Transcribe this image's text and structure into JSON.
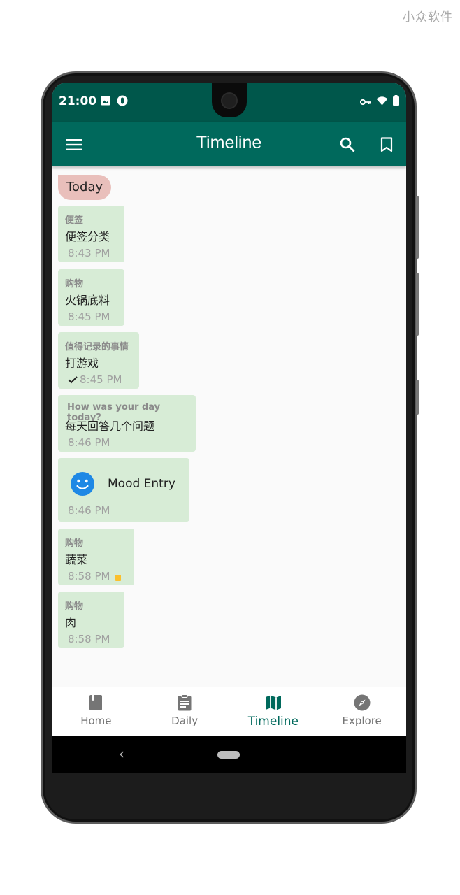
{
  "watermark": "小众软件",
  "status_bar": {
    "time": "21:00"
  },
  "app_bar": {
    "title": "Timeline",
    "menu_icon": "menu-icon",
    "search_icon": "search-icon",
    "bookmark_icon": "bookmark-icon"
  },
  "timeline": {
    "date_chip": "Today",
    "entries": [
      {
        "category": "便签",
        "text": "便签分类",
        "time": "8:43 PM"
      },
      {
        "category": "购物",
        "text": "火锅底料",
        "time": "8:45 PM"
      },
      {
        "category": "值得记录的事情",
        "text": "打游戏",
        "time": "8:45 PM",
        "checked": true
      },
      {
        "category": "How was your day today?",
        "text": "每天回答几个问题",
        "time": "8:46 PM"
      },
      {
        "type": "mood",
        "text": "Mood Entry",
        "time": "8:46 PM"
      },
      {
        "category": "购物",
        "text": "蔬菜",
        "time": "8:58 PM",
        "flag": "yellow"
      },
      {
        "category": "购物",
        "text": "肉",
        "time": "8:58 PM"
      }
    ]
  },
  "fab": {
    "icon": "filter-icon"
  },
  "bottom_nav": {
    "items": [
      {
        "label": "Home",
        "icon": "book-icon"
      },
      {
        "label": "Daily",
        "icon": "clipboard-icon"
      },
      {
        "label": "Timeline",
        "icon": "map-icon",
        "active": true
      },
      {
        "label": "Explore",
        "icon": "compass-icon"
      }
    ]
  },
  "colors": {
    "primary": "#00695c",
    "status_bar": "#00574b",
    "bubble": "#d7ecd6",
    "date_chip": "#e9bfbb",
    "fab": "#fdd835",
    "mood_face": "#1e88e5"
  }
}
